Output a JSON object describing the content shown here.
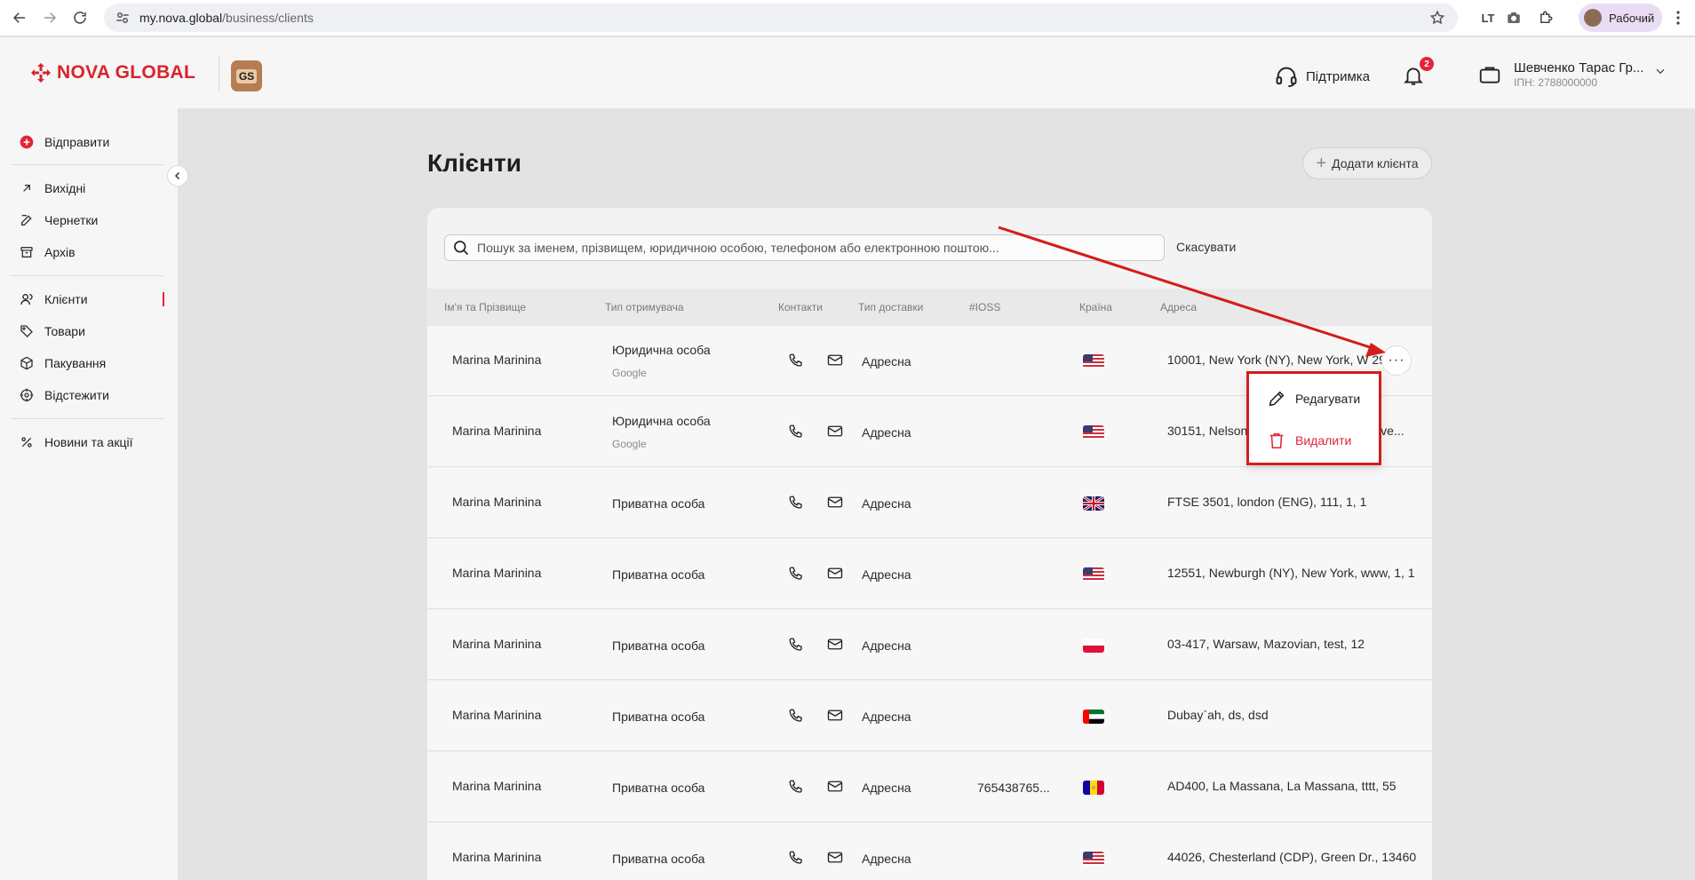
{
  "browser": {
    "url_host": "my.nova.global",
    "url_path": "/business/clients",
    "profile_label": "Рабочий"
  },
  "brand": {
    "logo_text": "NOVA GLOBAL",
    "account_badge": "GS",
    "accent_color": "#e32636"
  },
  "header": {
    "support_label": "Підтримка",
    "notifications_count": "2",
    "user_name": "Шевченко Тарас Гр...",
    "user_inn": "ІПН: 2788000000"
  },
  "sidebar": {
    "send_label": "Відправити",
    "items": [
      {
        "label": "Вихідні",
        "icon": "arrow-up-right-icon"
      },
      {
        "label": "Чернетки",
        "icon": "edit-icon"
      },
      {
        "label": "Архів",
        "icon": "archive-icon"
      },
      {
        "label": "Клієнти",
        "icon": "users-icon",
        "active": true
      },
      {
        "label": "Товари",
        "icon": "tag-icon"
      },
      {
        "label": "Пакування",
        "icon": "box-icon"
      },
      {
        "label": "Відстежити",
        "icon": "track-icon"
      },
      {
        "label": "Новини та акції",
        "icon": "percent-icon"
      }
    ]
  },
  "main": {
    "title": "Клієнти",
    "add_button_label": "Додати клієнта",
    "search_placeholder": "Пошук за іменем, прізвищем, юридичною особою, телефоном або електронною поштою...",
    "cancel_label": "Скасувати",
    "columns": [
      "Ім'я та Прізвище",
      "Тип отримувача",
      "Контакти",
      "Тип доставки",
      "#IOSS",
      "Країна",
      "Адреса"
    ],
    "rows": [
      {
        "name": "Marina Marinina",
        "type": "Юридична особа",
        "source": "Google",
        "delivery": "Адресна",
        "ioss": "",
        "country": "us",
        "address": "10001, New York (NY), New York, W 29..."
      },
      {
        "name": "Marina Marinina",
        "type": "Юридична особа",
        "source": "Google",
        "delivery": "Адресна",
        "ioss": "",
        "country": "us",
        "address": "30151, Nelson (GA), ..., 1, Gramercy Ave..."
      },
      {
        "name": "Marina Marinina",
        "type": "Приватна особа",
        "source": "",
        "delivery": "Адресна",
        "ioss": "",
        "country": "gb",
        "address": "FTSE 3501, london (ENG), 111, 1, 1"
      },
      {
        "name": "Marina Marinina",
        "type": "Приватна особа",
        "source": "",
        "delivery": "Адресна",
        "ioss": "",
        "country": "us",
        "address": "12551, Newburgh (NY), New York, www, 1, 1"
      },
      {
        "name": "Marina Marinina",
        "type": "Приватна особа",
        "source": "",
        "delivery": "Адресна",
        "ioss": "",
        "country": "pl",
        "address": "03-417, Warsaw, Mazovian, test, 12"
      },
      {
        "name": "Marina Marinina",
        "type": "Приватна особа",
        "source": "",
        "delivery": "Адресна",
        "ioss": "",
        "country": "ae",
        "address": "Dubay`ah, ds, dsd"
      },
      {
        "name": "Marina Marinina",
        "type": "Приватна особа",
        "source": "",
        "delivery": "Адресна",
        "ioss": "765438765...",
        "country": "ad",
        "address": "AD400, La Massana, La Massana, tttt, 55"
      },
      {
        "name": "Marina Marinina",
        "type": "Приватна особа",
        "source": "",
        "delivery": "Адресна",
        "ioss": "",
        "country": "us",
        "address": "44026, Chesterland (CDP), Green Dr., 13460"
      }
    ]
  },
  "context_menu": {
    "edit_label": "Редагувати",
    "delete_label": "Видалити",
    "highlight_color": "#d41c1c"
  }
}
